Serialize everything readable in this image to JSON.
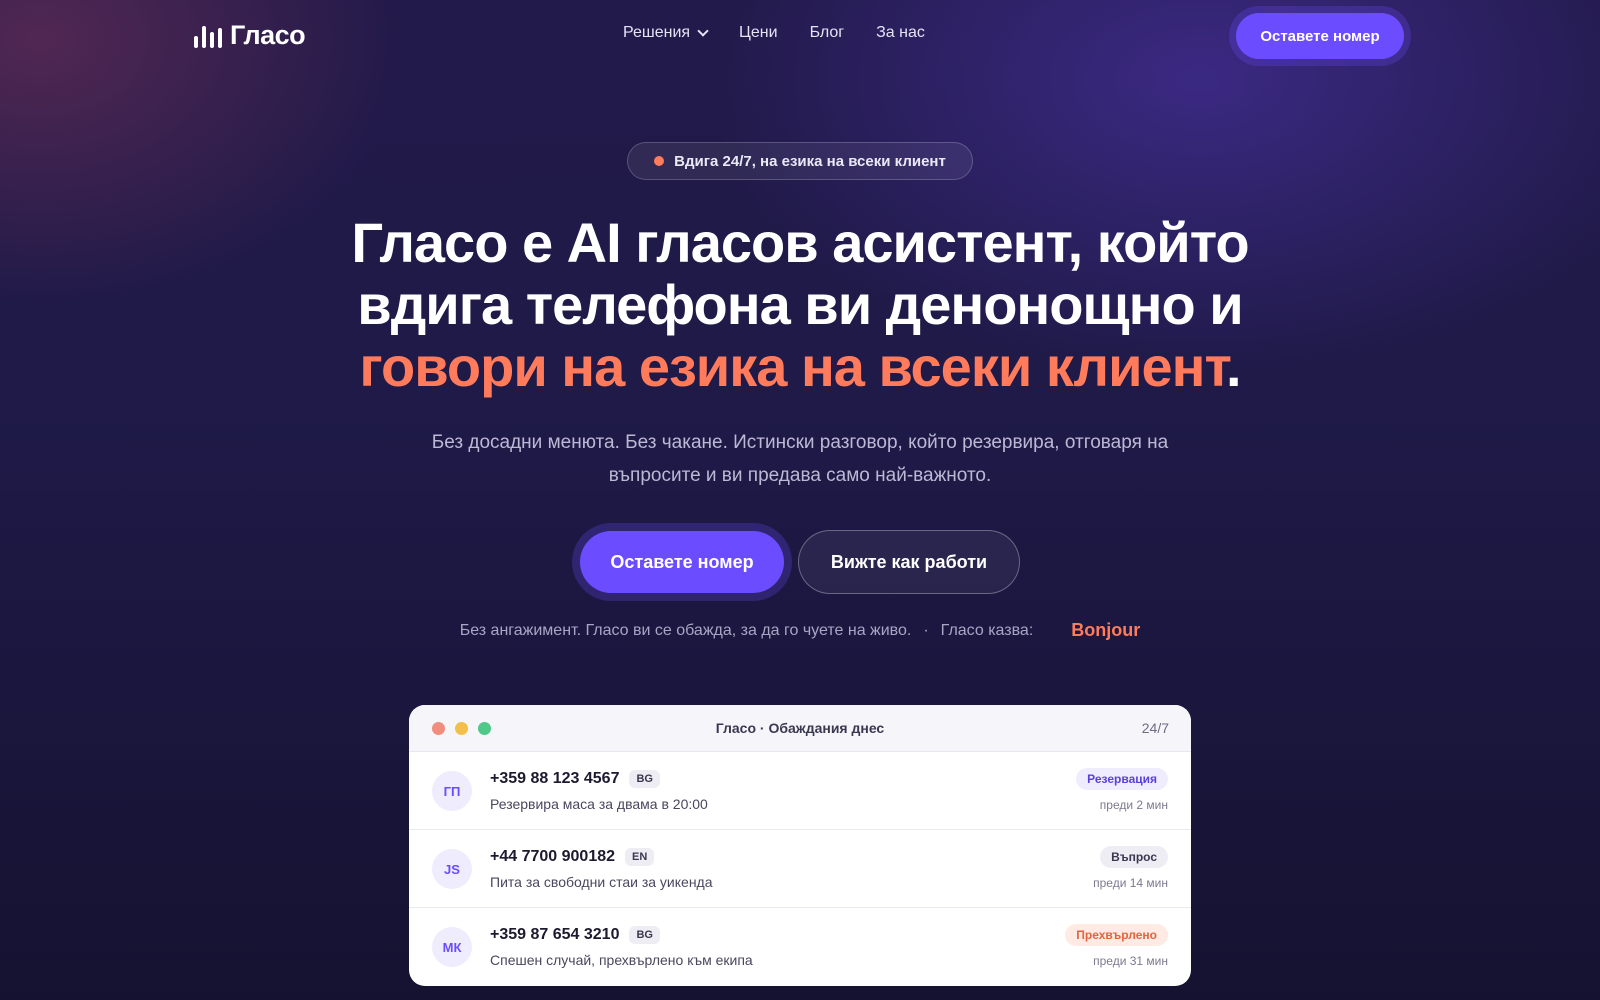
{
  "nav": {
    "logo_text": "Гласо",
    "links": [
      {
        "label": "Решения",
        "has_dropdown": true
      },
      {
        "label": "Цени"
      },
      {
        "label": "Блог"
      },
      {
        "label": "За нас"
      }
    ],
    "cta_label": "Оставете номер"
  },
  "badge": {
    "text": "Вдига 24/7, на езика на всеки клиент"
  },
  "hero": {
    "title_part1": "Гласо е AI гласов асистент, който вдига телефона ви денонощно и ",
    "title_accent": "говори на езика на всеки клиент",
    "title_end": ".",
    "subtitle": "Без досадни менюта. Без чакане. Истински разговор, който резервира, отговаря на въпросите и ви предава само най-важното.",
    "cta_primary": "Оставете номер",
    "cta_secondary": "Вижте как работи",
    "note_text": "Без ангажимент. Гласо ви се обажда, за да го чуете на живо.",
    "note_separator": "·",
    "says_label": "Гласо казва:",
    "says_word": "Bonjour"
  },
  "calls_card": {
    "title": "Гласо · Обаждания днес",
    "badge": "24/7",
    "rows": [
      {
        "initials": "ГП",
        "phone": "+359 88 123 4567",
        "lang": "BG",
        "desc": "Резервира маса за двама в 20:00",
        "tag": "Резервация",
        "time": "преди 2 мин"
      },
      {
        "initials": "JS",
        "phone": "+44 7700 900182",
        "lang": "EN",
        "desc": "Пита за свободни стаи за уикенда",
        "tag": "Въпрос",
        "time": "преди 14 мин"
      },
      {
        "initials": "МК",
        "phone": "+359 87 654 3210",
        "lang": "BG",
        "desc": "Спешен случай, прехвърлено към екипа",
        "tag": "Прехвърлено",
        "time": "преди 31 мин"
      }
    ]
  },
  "colors": {
    "accent": "#ff7b5c",
    "primary": "#6b4cff",
    "background": "#1f1a48",
    "window_dot_red": "#f08d7e",
    "window_dot_yellow": "#f2c04a",
    "window_dot_green": "#4fc88a"
  }
}
